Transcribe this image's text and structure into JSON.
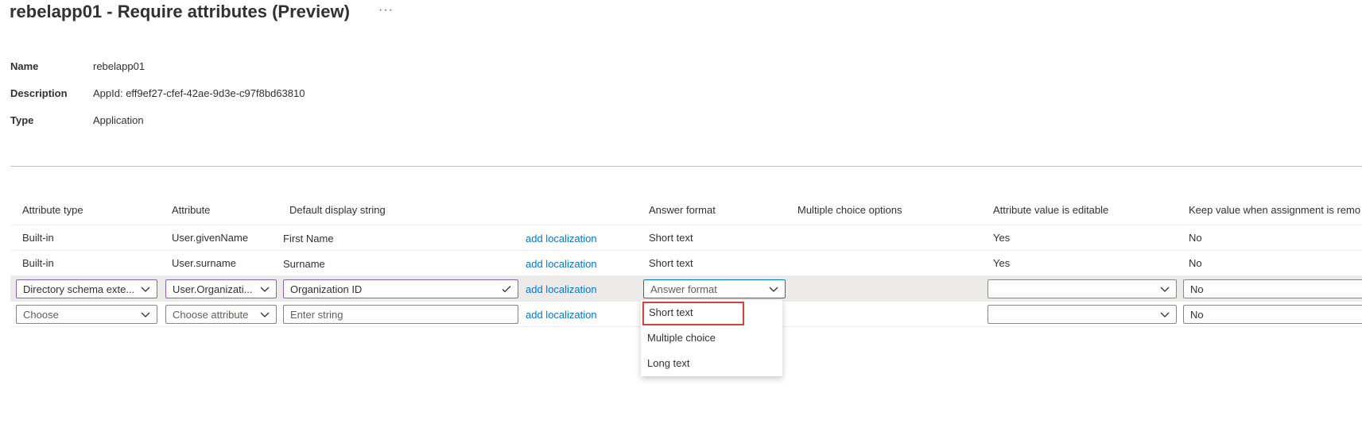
{
  "page": {
    "title": "rebelapp01 - Require attributes (Preview)",
    "more_label": "···"
  },
  "properties": [
    {
      "key": "Name",
      "value": "rebelapp01"
    },
    {
      "key": "Description",
      "value": "AppId: eff9ef27-cfef-42ae-9d3e-c97f8bd63810"
    },
    {
      "key": "Type",
      "value": "Application"
    }
  ],
  "grid": {
    "headers": {
      "attribute_type": "Attribute type",
      "attribute": "Attribute",
      "default_display_string": "Default display string",
      "answer_format": "Answer format",
      "multiple_choice_options": "Multiple choice options",
      "attribute_value_editable": "Attribute value is editable",
      "keep_value": "Keep value when assignment is remo"
    },
    "rows": [
      {
        "attribute_type": "Built-in",
        "attribute": "User.givenName",
        "display_string": "First Name",
        "localization": "add localization",
        "answer_format": "Short text",
        "editable": "Yes",
        "keep": "No"
      },
      {
        "attribute_type": "Built-in",
        "attribute": "User.surname",
        "display_string": "Surname",
        "localization": "add localization",
        "answer_format": "Short text",
        "editable": "Yes",
        "keep": "No"
      },
      {
        "attribute_type": "Directory schema exte...",
        "attribute": "User.Organizati...",
        "display_string": "Organization ID",
        "localization": "add localization",
        "answer_format_placeholder": "Answer format",
        "editable": "",
        "keep": "No"
      },
      {
        "attribute_type_placeholder": "Choose",
        "attribute_placeholder": "Choose attribute",
        "display_string_placeholder": "Enter string",
        "localization": "add localization",
        "editable": "",
        "keep": "No"
      }
    ]
  },
  "answer_format_dropdown": {
    "options": [
      "Short text",
      "Multiple choice",
      "Long text"
    ],
    "highlighted": "Short text"
  },
  "colors": {
    "link": "#0078d4",
    "active_border": "#8764b8",
    "focus_border": "#0078d4",
    "highlight_outline": "#e03c3c",
    "selected_row_bg": "#edebe9"
  }
}
